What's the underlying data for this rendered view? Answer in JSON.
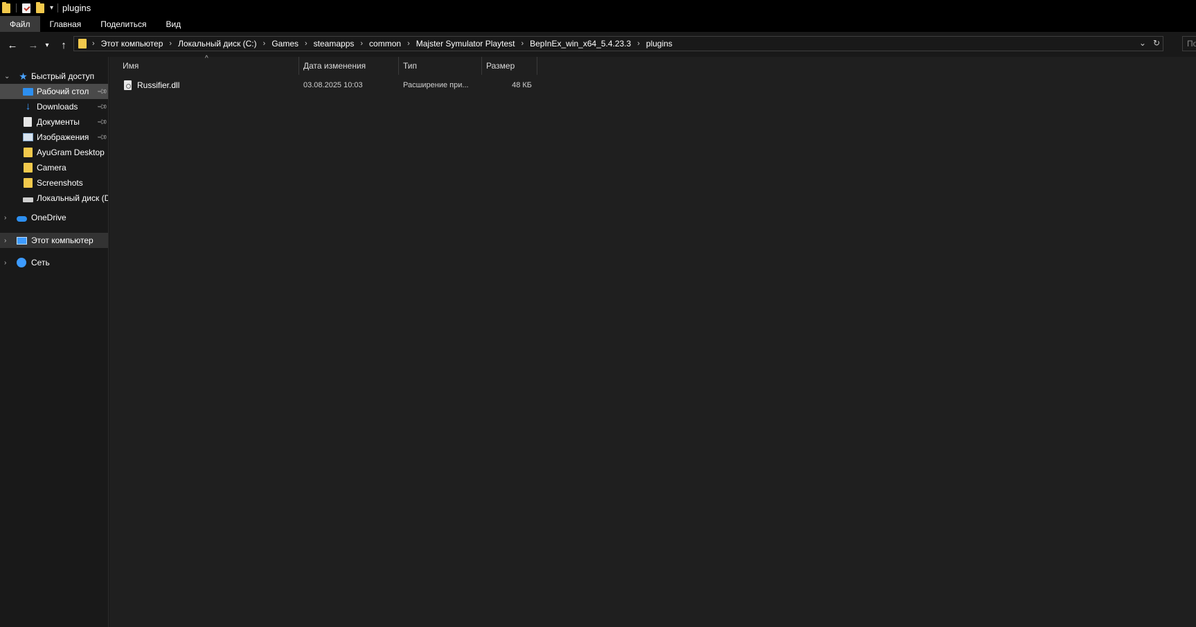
{
  "window": {
    "title": "plugins"
  },
  "ribbon": {
    "tabs": [
      {
        "label": "Файл",
        "active": true
      },
      {
        "label": "Главная",
        "active": false
      },
      {
        "label": "Поделиться",
        "active": false
      },
      {
        "label": "Вид",
        "active": false
      }
    ]
  },
  "nav": {
    "back_icon": "arrow-left-icon",
    "forward_icon": "arrow-right-icon",
    "recent_icon": "chevron-down-icon",
    "up_icon": "arrow-up-icon",
    "breadcrumbs": [
      "Этот компьютер",
      "Локальный диск (C:)",
      "Games",
      "steamapps",
      "common",
      "Majster Symulator Playtest",
      "BepInEx_win_x64_5.4.23.3",
      "plugins"
    ],
    "search_placeholder": "По"
  },
  "sidebar": {
    "quick_access": {
      "label": "Быстрый доступ",
      "icon": "star-icon"
    },
    "items": [
      {
        "label": "Рабочий стол",
        "icon": "desktop-icon",
        "pinned": true,
        "selected": true
      },
      {
        "label": "Downloads",
        "icon": "download-icon",
        "pinned": true
      },
      {
        "label": "Документы",
        "icon": "document-icon",
        "pinned": true
      },
      {
        "label": "Изображения",
        "icon": "pictures-icon",
        "pinned": true
      },
      {
        "label": "AyuGram Desktop",
        "icon": "folder-icon"
      },
      {
        "label": "Camera",
        "icon": "folder-icon"
      },
      {
        "label": "Screenshots",
        "icon": "folder-icon"
      },
      {
        "label": "Локальный диск (D",
        "icon": "drive-icon"
      }
    ],
    "onedrive": {
      "label": "OneDrive",
      "icon": "cloud-icon"
    },
    "this_pc": {
      "label": "Этот компьютер",
      "icon": "computer-icon"
    },
    "network": {
      "label": "Сеть",
      "icon": "network-icon"
    }
  },
  "columns": {
    "name": "Имя",
    "date": "Дата изменения",
    "type": "Тип",
    "size": "Размер"
  },
  "files": [
    {
      "name": "Russifier.dll",
      "date": "03.08.2025 10:03",
      "type": "Расширение при...",
      "size": "48 КБ",
      "icon": "dll-file-icon"
    }
  ],
  "colors": {
    "background": "#191919",
    "content": "#1f1f1f",
    "titlebar": "#000000",
    "folder": "#f2c94c",
    "accent": "#2d8ff0"
  }
}
